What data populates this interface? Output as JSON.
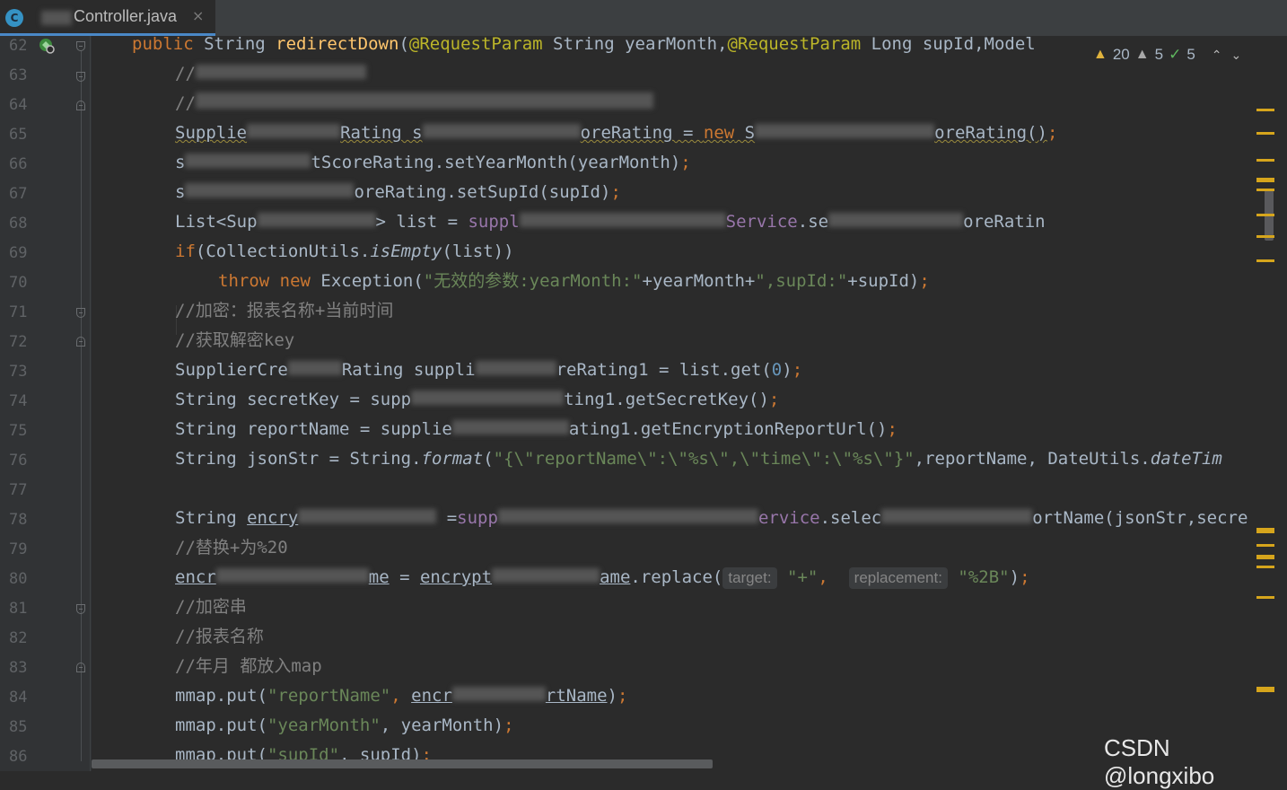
{
  "tab": {
    "filename": "Controller.java",
    "icon_letter": "C",
    "close": "×"
  },
  "inspections": {
    "warnings": "20",
    "weak_warnings": "5",
    "typos": "5"
  },
  "watermark": "CSDN @longxibo",
  "line_numbers": [
    "62",
    "63",
    "64",
    "65",
    "66",
    "67",
    "68",
    "69",
    "70",
    "71",
    "72",
    "73",
    "74",
    "75",
    "76",
    "77",
    "78",
    "79",
    "80",
    "81",
    "82",
    "83",
    "84",
    "85",
    "86"
  ],
  "code": {
    "l62": {
      "kw": "public ",
      "type": "String ",
      "fn": "redirectDown",
      "p1": "(",
      "an1": "@RequestParam",
      "p2": " String yearMonth,",
      "an2": "@RequestParam",
      "p3": " Long supId,Model"
    },
    "l63": {
      "cmt": "//"
    },
    "l64": {
      "cmt": "//"
    },
    "l65": {
      "a": "Supplie",
      "b": "Rating s",
      "c": "oreRating = ",
      "kw": "new",
      "d": " S",
      "e": "oreRating()",
      "semi": ";"
    },
    "l66": {
      "a": "s",
      "b": "tScoreRating.setYearMonth(yearMonth)",
      "semi": ";"
    },
    "l67": {
      "a": "s",
      "b": "oreRating.setSupId(supId)",
      "semi": ";"
    },
    "l68": {
      "a": "List<Sup",
      "b": "> list = ",
      "fld": "suppl",
      "fld2": "Service",
      "c": ".se",
      "d": "oreRatin"
    },
    "l69": {
      "kw": "if",
      "a": "(CollectionUtils.",
      "it": "isEmpty",
      "b": "(list))"
    },
    "l70": {
      "kw": "throw new ",
      "a": "Exception(",
      "str": "\"无效的参数:yearMonth:\"",
      "b": "+yearMonth+",
      "str2": "\",supId:\"",
      "c": "+supId)",
      "semi": ";"
    },
    "l71": {
      "cmt": "//加密：报表名称+当前时间"
    },
    "l72": {
      "cmt": "//获取解密key"
    },
    "l73": {
      "a": "SupplierCre",
      "b": "Rating suppli",
      "c": "reRating1 = list.get(",
      "num": "0",
      "d": ")",
      "semi": ";"
    },
    "l74": {
      "a": "String secretKey = supp",
      "b": "ting1.getSecretKey()",
      "semi": ";"
    },
    "l75": {
      "a": "String reportName = supplie",
      "b": "ating1.getEncryptionReportUrl()",
      "semi": ";"
    },
    "l76": {
      "a": "String jsonStr = String.",
      "it": "format",
      "b": "(",
      "str": "\"{\\\"reportName\\\":\\\"%s\\\",\\\"time\\\":\\\"%s\\\"}\"",
      "c": ",reportName, DateUtils.",
      "it2": "dateTim"
    },
    "l77": {},
    "l78": {
      "a": "String ",
      "u": "encry",
      "b": " =",
      "fld": "supp",
      "fld2": "ervice",
      "c": ".selec",
      "d": "ortName(jsonStr,secre"
    },
    "l79": {
      "cmt": "//替换+为%20"
    },
    "l80": {
      "u1": "encr",
      "u2": "me",
      "a": " = ",
      "u3": "encrypt",
      "u4": "ame",
      "b": ".replace(",
      "h1": "target:",
      "s1": "\"+\"",
      "c": ", ",
      "h2": "replacement:",
      "s2": "\"%2B\"",
      "d": ")",
      "semi": ";"
    },
    "l81": {
      "cmt": "//加密串"
    },
    "l82": {
      "cmt": "//报表名称"
    },
    "l83": {
      "cmt": "//年月 都放入map"
    },
    "l84": {
      "a": "mmap.put(",
      "str": "\"reportName\"",
      "b": ", ",
      "u": "encr",
      "u2": "rtName",
      "c": ")",
      "semi": ";"
    },
    "l85": {
      "a": "mmap.put(",
      "str": "\"yearMonth\"",
      "b": ", yearMonth)",
      "semi": ";"
    },
    "l86": {
      "a": "mmap.put(",
      "str": "\"supId\"",
      "b": ", supId)",
      "semi": ";"
    }
  },
  "colors": {
    "background": "#2b2b2b",
    "keyword": "#cc7832",
    "string": "#6a8759",
    "comment": "#808080",
    "method": "#ffc66d",
    "annotation": "#bbb529",
    "field": "#9876aa",
    "number": "#6897bb",
    "warning": "#e0b33d"
  }
}
